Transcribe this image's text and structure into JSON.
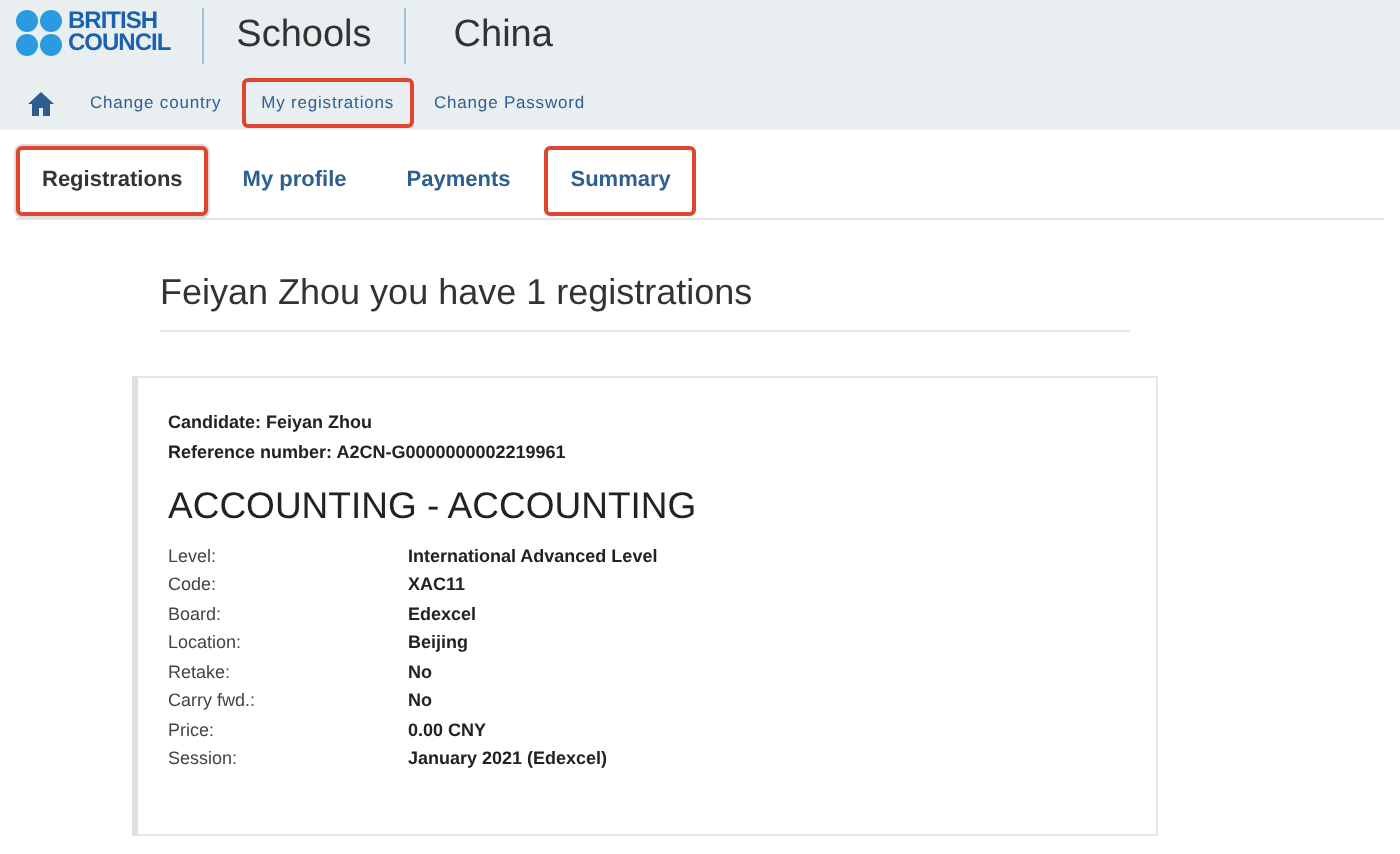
{
  "brand": {
    "logo_line_1": "BRITISH",
    "logo_line_2": "COUNCIL",
    "section": "Schools",
    "country": "China"
  },
  "nav": [
    {
      "label": "Change country",
      "highlighted": false
    },
    {
      "label": "My registrations",
      "highlighted": true
    },
    {
      "label": "Change Password",
      "highlighted": false
    }
  ],
  "tabs": [
    {
      "label": "Registrations",
      "selected": true,
      "highlighted": true
    },
    {
      "label": "My profile",
      "selected": false,
      "highlighted": false
    },
    {
      "label": "Payments",
      "selected": false,
      "highlighted": false
    },
    {
      "label": "Summary",
      "selected": false,
      "highlighted": true
    }
  ],
  "heading": "Feiyan Zhou you have 1 registrations",
  "registration": {
    "candidate": "Candidate: Feiyan Zhou",
    "reference": "Reference number: A2CN-G0000000002219961",
    "title": "ACCOUNTING - ACCOUNTING",
    "details": [
      {
        "label": "Level:",
        "value": "International Advanced Level"
      },
      {
        "label": "Code:",
        "value": "XAC11"
      },
      {
        "label": "Board:",
        "value": "Edexcel"
      },
      {
        "label": "Location:",
        "value": "Beijing"
      },
      {
        "label": "Retake:",
        "value": "No"
      },
      {
        "label": "Carry fwd.:",
        "value": "No"
      },
      {
        "label": "Price:",
        "value": "0.00 CNY"
      },
      {
        "label": "Session:",
        "value": "January 2021 (Edexcel)"
      }
    ]
  }
}
